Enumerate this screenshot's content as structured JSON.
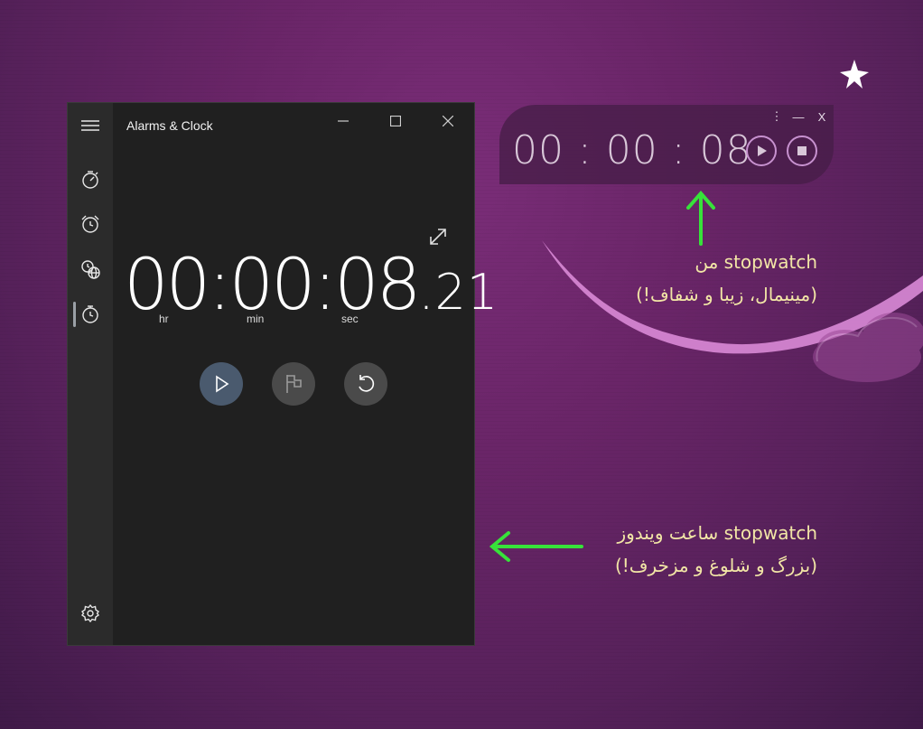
{
  "window": {
    "title": "Alarms & Clock",
    "nav": [
      "menu-icon",
      "timer-icon",
      "alarm-icon",
      "world-clock-icon",
      "stopwatch-icon",
      "settings-icon"
    ],
    "stopwatch": {
      "main": "00:00:08",
      "fraction": ".21",
      "units": {
        "hr": "hr",
        "min": "min",
        "sec": "sec"
      }
    },
    "controls": [
      "play-icon",
      "lap-flag-icon",
      "reset-icon"
    ]
  },
  "mini": {
    "time": "00 : 00 : 08",
    "menu_glyph": "⋮",
    "minimize_glyph": "—",
    "close_label": "X"
  },
  "annotations": {
    "mini_line1": "stopwatch من",
    "mini_line2": "(مینیمال، زیبا و شفاف!)",
    "win_line1": "stopwatch ساعت ویندوز",
    "win_line2": "(بزرگ و شلوغ و مزخرف!)"
  },
  "colors": {
    "arrow": "#37e23a",
    "annotation_text": "#f2e6a6",
    "mini_accent": "#c791cf",
    "play_button": "#4a5a6e"
  }
}
